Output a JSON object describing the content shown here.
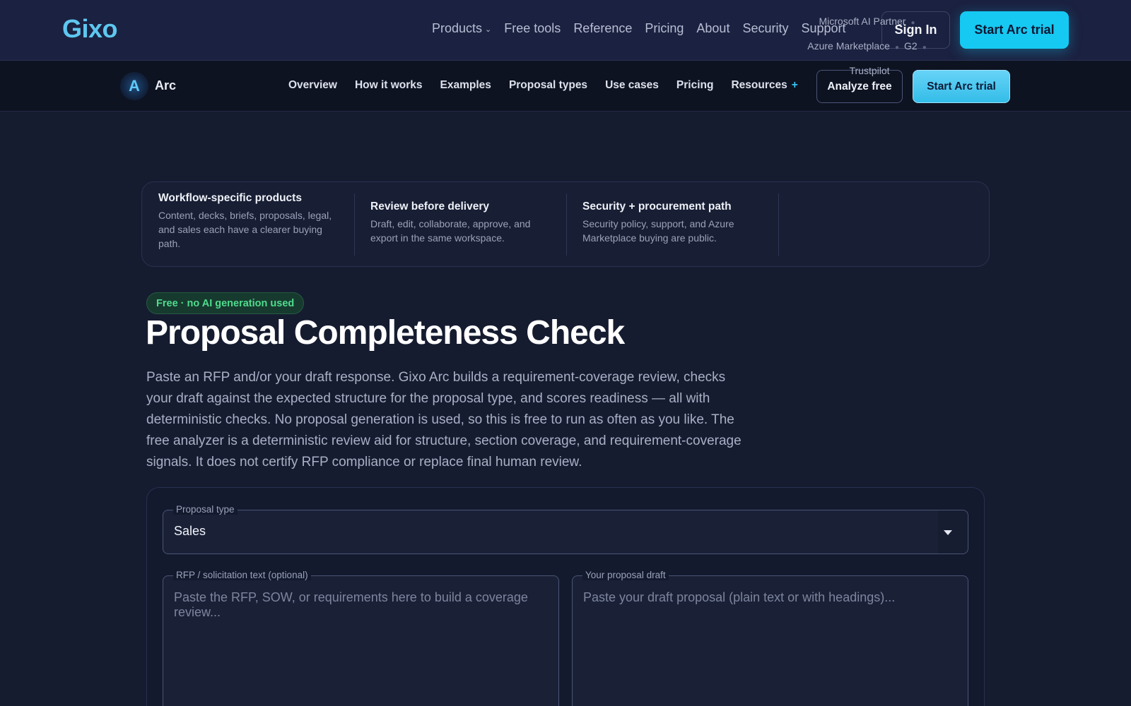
{
  "brand": {
    "logo": "Gixo"
  },
  "topnav": {
    "items": [
      "Products",
      "Free tools",
      "Reference",
      "Pricing",
      "About",
      "Security",
      "Support"
    ],
    "sign_in": "Sign In",
    "trial": "Start Arc trial"
  },
  "subnav": {
    "product_mark": "A",
    "product_name": "Arc",
    "items": [
      "Overview",
      "How it works",
      "Examples",
      "Proposal types",
      "Use cases",
      "Pricing",
      "Resources"
    ],
    "resources_plus": "+",
    "analyze": "Analyze free",
    "trial": "Start Arc trial"
  },
  "trust": {
    "columns": [
      {
        "title": "Workflow-specific products",
        "text": "Content, decks, briefs, proposals, legal, and sales each have a clearer buying path."
      },
      {
        "title": "Review before delivery",
        "text": "Draft, edit, collaborate, approve, and export in the same workspace."
      },
      {
        "title": "Security + procurement path",
        "text": "Security policy, support, and Azure Marketplace buying are public."
      }
    ],
    "badges": [
      "Microsoft AI Partner",
      "Azure Marketplace",
      "G2",
      "Trustpilot"
    ]
  },
  "hero": {
    "pill": "Free · no AI generation used",
    "title": "Proposal Completeness Check",
    "lead": "Paste an RFP and/or your draft response. Gixo Arc builds a requirement-coverage review, checks your draft against the expected structure for the proposal type, and scores readiness — all with deterministic checks. No proposal generation is used, so this is free to run as often as you like. The free analyzer is a deterministic review aid for structure, section coverage, and requirement-coverage signals. It does not certify RFP compliance or replace final human review."
  },
  "form": {
    "proposal_type_label": "Proposal type",
    "proposal_type_value": "Sales",
    "rfp_label": "RFP / solicitation text (optional)",
    "rfp_placeholder": "Paste the RFP, SOW, or requirements here to build a coverage review...",
    "draft_label": "Your proposal draft",
    "draft_placeholder": "Paste your draft proposal (plain text or with headings)..."
  },
  "colors": {
    "accent": "#16c9f2",
    "logo": "#5ec7f0",
    "pill_text": "#4fdc8c",
    "background": "#161c30"
  }
}
